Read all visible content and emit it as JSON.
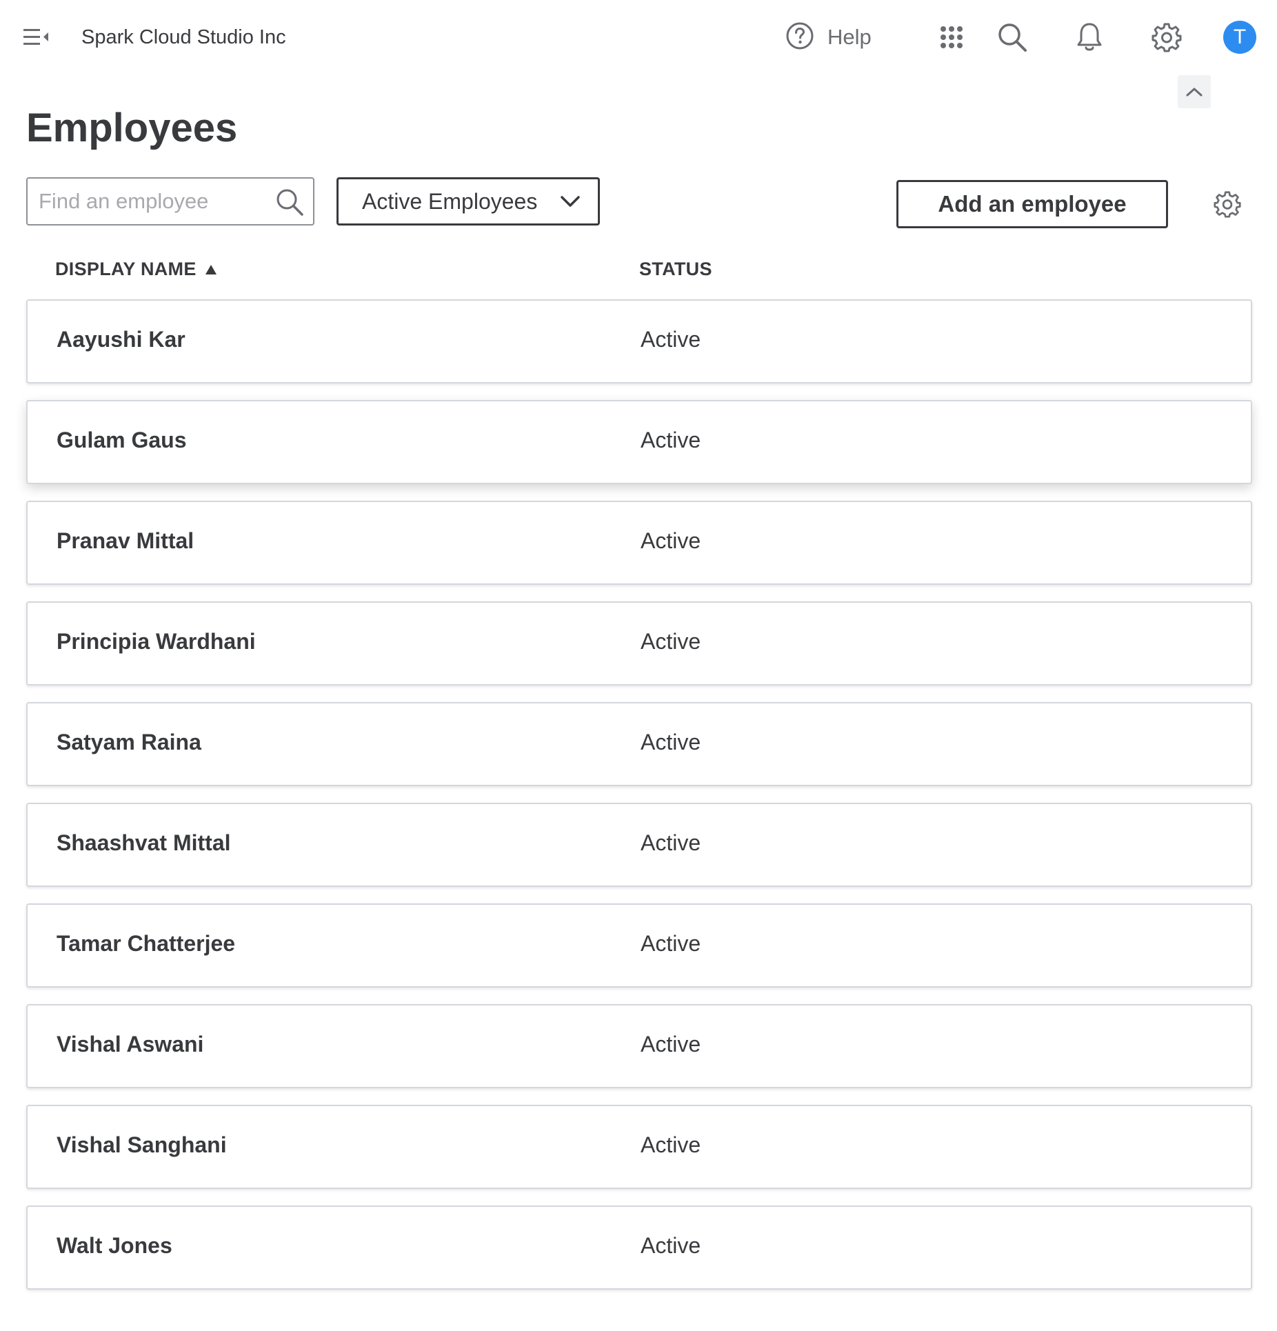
{
  "topbar": {
    "company_name": "Spark Cloud Studio Inc",
    "help_label": "Help",
    "avatar_initial": "T",
    "avatar_color": "#2d8cf0",
    "icons": [
      "menu-collapse-icon",
      "help-circle-icon",
      "apps-grid-icon",
      "search-icon",
      "bell-icon",
      "gear-icon",
      "chevron-up-icon"
    ]
  },
  "page": {
    "title": "Employees"
  },
  "toolbar": {
    "search_placeholder": "Find an employee",
    "search_value": "",
    "filter_selected": "Active Employees",
    "add_label": "Add an employee"
  },
  "table": {
    "columns": [
      {
        "label": "DISPLAY NAME",
        "sort": "ascending"
      },
      {
        "label": "STATUS"
      }
    ],
    "rows": [
      {
        "name": "Aayushi Kar",
        "status": "Active"
      },
      {
        "name": "Gulam Gaus",
        "status": "Active"
      },
      {
        "name": "Pranav Mittal",
        "status": "Active"
      },
      {
        "name": "Principia Wardhani",
        "status": "Active"
      },
      {
        "name": "Satyam Raina",
        "status": "Active"
      },
      {
        "name": "Shaashvat Mittal",
        "status": "Active"
      },
      {
        "name": "Tamar Chatterjee",
        "status": "Active"
      },
      {
        "name": "Vishal Aswani",
        "status": "Active"
      },
      {
        "name": "Vishal Sanghani",
        "status": "Active"
      },
      {
        "name": "Walt Jones",
        "status": "Active"
      }
    ]
  }
}
